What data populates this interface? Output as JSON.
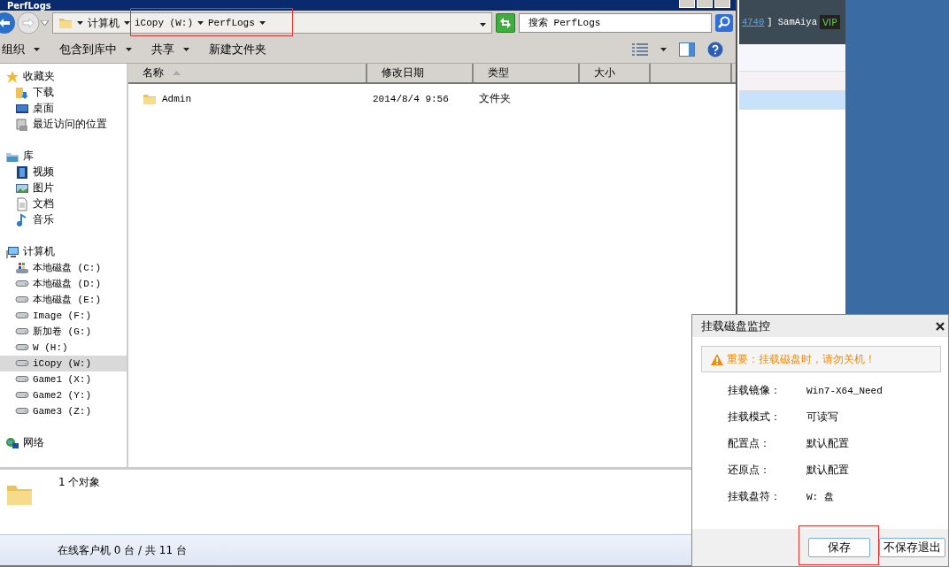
{
  "background_app": {
    "user_link": "4740",
    "user_name": "] SamAiya",
    "badge": "VIP",
    "rows": [
      {
        "selected": false
      },
      {
        "selected": true
      }
    ],
    "status": "在线客户机 0 台 / 共 11 台"
  },
  "explorer": {
    "title": "PerfLogs",
    "breadcrumb": {
      "highlighted": true,
      "parts": [
        "计算机",
        "iCopy (W:)",
        "PerfLogs"
      ]
    },
    "search": {
      "placeholder": "搜索 PerfLogs"
    },
    "toolbar": [
      {
        "label": "组织",
        "dropdown": true
      },
      {
        "label": "包含到库中",
        "dropdown": true
      },
      {
        "label": "共享",
        "dropdown": true
      },
      {
        "label": "新建文件夹",
        "dropdown": false
      }
    ],
    "nav": [
      {
        "label": "收藏夹",
        "selected": false,
        "children": [
          {
            "label": "下载",
            "selected": false
          },
          {
            "label": "桌面",
            "selected": false
          },
          {
            "label": "最近访问的位置",
            "selected": false
          }
        ]
      },
      {
        "label": "库",
        "selected": false,
        "children": [
          {
            "label": "视频",
            "selected": false
          },
          {
            "label": "图片",
            "selected": false
          },
          {
            "label": "文档",
            "selected": false
          },
          {
            "label": "音乐",
            "selected": false
          }
        ]
      },
      {
        "label": "计算机",
        "selected": false,
        "children": [
          {
            "label": "本地磁盘 (C:)",
            "selected": false
          },
          {
            "label": "本地磁盘 (D:)",
            "selected": false
          },
          {
            "label": "本地磁盘 (E:)",
            "selected": false
          },
          {
            "label": "Image (F:)",
            "selected": false
          },
          {
            "label": "新加卷 (G:)",
            "selected": false
          },
          {
            "label": "W (H:)",
            "selected": false
          },
          {
            "label": "iCopy (W:)",
            "selected": true
          },
          {
            "label": "Game1 (X:)",
            "selected": false
          },
          {
            "label": "Game2 (Y:)",
            "selected": false
          },
          {
            "label": "Game3 (Z:)",
            "selected": false
          }
        ]
      },
      {
        "label": "网络",
        "selected": false
      }
    ],
    "columns": [
      {
        "label": "名称",
        "sorted": true
      },
      {
        "label": "修改日期",
        "sorted": false
      },
      {
        "label": "类型",
        "sorted": false
      },
      {
        "label": "大小",
        "sorted": false
      }
    ],
    "files": [
      {
        "name": "Admin",
        "modified": "2014/8/4 9:56",
        "type": "文件夹"
      }
    ],
    "details": "1 个对象"
  },
  "dialog": {
    "title": "挂载磁盘监控",
    "warning": "重要：挂载磁盘时，请勿关机！",
    "fields": [
      {
        "label": "挂载镜像：",
        "value": "Win7-X64_Need"
      },
      {
        "label": "挂载模式：",
        "value": "可读写"
      },
      {
        "label": "配置点：",
        "value": "默认配置"
      },
      {
        "label": "还原点：",
        "value": "默认配置"
      },
      {
        "label": "挂载盘符：",
        "value": "W: 盘"
      }
    ],
    "buttons": [
      {
        "label": "保存",
        "highlighted": true
      },
      {
        "label": "不保存退出",
        "highlighted": false
      }
    ]
  }
}
